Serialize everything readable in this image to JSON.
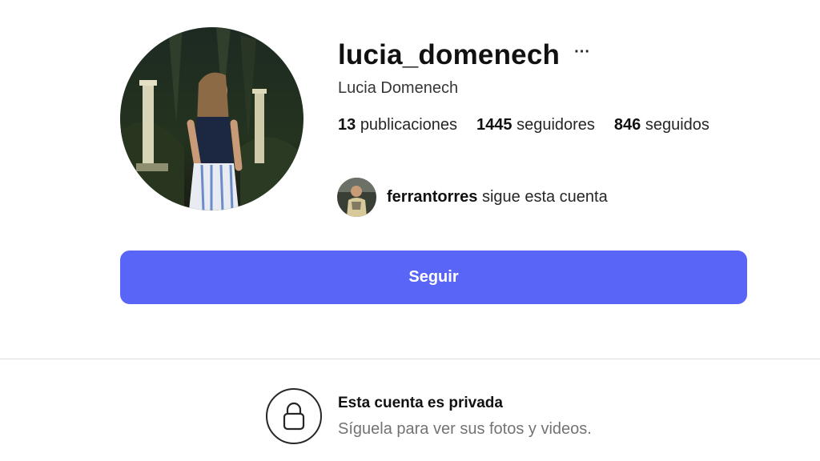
{
  "profile": {
    "username": "lucia_domenech",
    "more_label": "···",
    "full_name": "Lucia Domenech",
    "stats": [
      {
        "count": "13",
        "label": "publicaciones"
      },
      {
        "count": "1445",
        "label": "seguidores"
      },
      {
        "count": "846",
        "label": "seguidos"
      }
    ],
    "followed_by": {
      "username": "ferrantorres",
      "text": "sigue esta cuenta"
    }
  },
  "actions": {
    "follow_label": "Seguir"
  },
  "private_notice": {
    "title": "Esta cuenta es privada",
    "subtitle": "Síguela para ver sus fotos y videos."
  },
  "icons": {
    "more": "more-horizontal-icon",
    "lock": "lock-icon"
  },
  "colors": {
    "follow_button": "#5865f7",
    "divider": "#dbdbdb",
    "muted_text": "#737373"
  }
}
